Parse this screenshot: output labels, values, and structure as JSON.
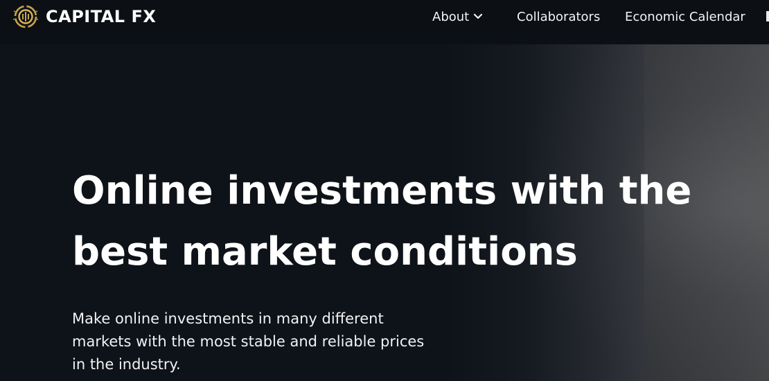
{
  "brand": {
    "name": "CAPITAL FX",
    "logo_icon": "capital-fx-coin-logo",
    "accent_color": "#c9a34a"
  },
  "nav": {
    "items": [
      {
        "label": "About",
        "icon": "chevron-down-icon"
      },
      {
        "label": "Collaborators"
      },
      {
        "label": "Economic Calendar"
      }
    ]
  },
  "hero": {
    "title_line1": "Online investments with the",
    "title_line2": "best market conditions",
    "subtitle_line1": "Make online investments in many different",
    "subtitle_line2": "markets with the most stable and reliable prices",
    "subtitle_line3": "in the industry."
  },
  "colors": {
    "navbar_bg": "#0c1015",
    "hero_bg": "#0e1319",
    "text": "#ffffff"
  }
}
